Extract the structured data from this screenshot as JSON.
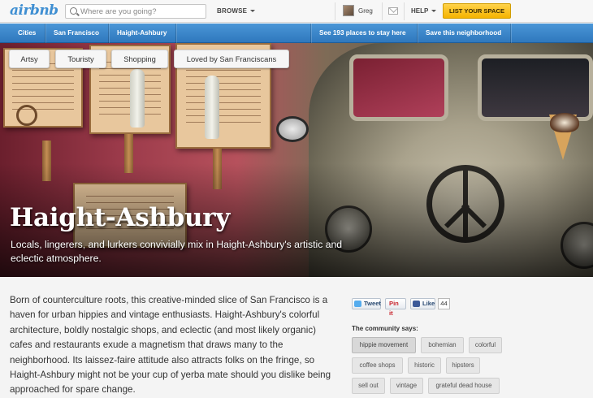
{
  "header": {
    "logo": "airbnb",
    "search_placeholder": "Where are you going?",
    "browse_label": "BROWSE",
    "username": "Greg",
    "help_label": "HELP",
    "list_space_label": "LIST YOUR SPACE"
  },
  "nav": {
    "breadcrumbs": [
      "Cities",
      "San Francisco",
      "Haight-Ashbury"
    ],
    "places_link": "See 193 places to stay here",
    "save_link": "Save this neighborhood"
  },
  "hero": {
    "tags": [
      "Artsy",
      "Touristy",
      "Shopping",
      "Loved by San Franciscans"
    ],
    "title": "Haight-Ashbury",
    "subtitle": "Locals, lingerers, and lurkers convivially mix in Haight-Ashbury's artistic and eclectic atmosphere."
  },
  "body": {
    "description": "Born of counterculture roots, this creative-minded slice of San Francisco is a haven for urban hippies and vintage enthusiasts. Haight-Ashbury's colorful architecture, boldly nostalgic shops, and eclectic (and most likely organic) cafes and restaurants exude a magnetism that draws many to the neighborhood. Its laissez-faire attitude also attracts folks on the fringe, so Haight-Ashbury might not be your cup of yerba mate should you dislike being approached for spare change."
  },
  "social": {
    "tweet_label": "Tweet",
    "pin_label": "Pin it",
    "like_label": "Like",
    "like_count": "44"
  },
  "community": {
    "label": "The community says:",
    "tags": [
      "hippie movement",
      "bohemian",
      "colorful",
      "coffee shops",
      "historic",
      "hipsters",
      "sell out",
      "vintage",
      "grateful dead house"
    ]
  },
  "colors": {
    "brand_blue": "#3f8fd2",
    "nav_blue": "#2f78bd",
    "cta_yellow": "#f5b400"
  }
}
